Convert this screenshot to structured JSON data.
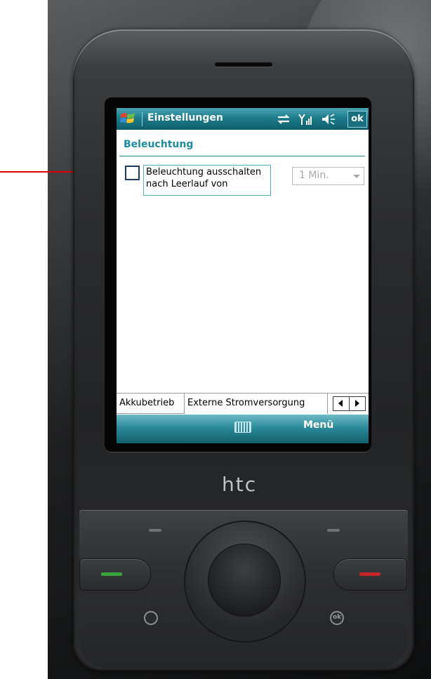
{
  "status_bar": {
    "title": "Einstellungen",
    "ok_label": "ok",
    "icons": [
      "windows-start-icon",
      "sync-icon",
      "signal-icon",
      "volume-icon"
    ]
  },
  "page": {
    "section_title": "Beleuchtung",
    "checkbox_label": "Beleuchtung ausschalten nach Leerlauf von",
    "checkbox_checked": false,
    "timeout_select_value": "1 Min.",
    "timeout_select_enabled": false
  },
  "tabs": {
    "items": [
      "Akkubetrieb",
      "Externe Stromversorgung"
    ],
    "active": "Externe Stromversorgung"
  },
  "softkeys": {
    "right_label": "Menü"
  },
  "device": {
    "brand": "htc"
  },
  "colors": {
    "accent": "#1d8c9e",
    "annotation_arrow": "#e00000"
  }
}
